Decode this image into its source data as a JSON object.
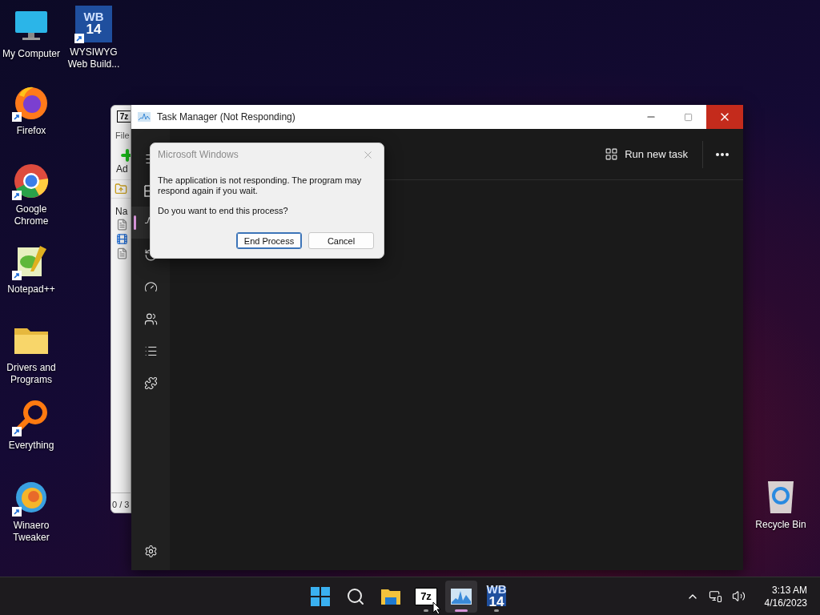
{
  "desktop_icons": [
    {
      "label": "My Computer",
      "kind": "computer",
      "shortcut": false
    },
    {
      "label": "WYSIWYG Web Build...",
      "kind": "wb",
      "logo": [
        "WB",
        "14"
      ],
      "shortcut": true
    },
    {
      "label": "Firefox",
      "kind": "firefox",
      "shortcut": true
    },
    {
      "label": "Google Chrome",
      "kind": "chrome",
      "shortcut": true
    },
    {
      "label": "Notepad++",
      "kind": "notepad",
      "shortcut": true
    },
    {
      "label": "Drivers and Programs",
      "kind": "folder",
      "shortcut": false
    },
    {
      "label": "Everything",
      "kind": "everything",
      "shortcut": true
    },
    {
      "label": "Winaero Tweaker",
      "kind": "winaero",
      "shortcut": true
    },
    {
      "label": "Recycle Bin",
      "kind": "recycle",
      "shortcut": false
    }
  ],
  "archive_window": {
    "logo": "7z",
    "menu": "File",
    "toolbar_button": "Ad",
    "column": "Na",
    "status": "0 / 3",
    "files": [
      {
        "kind": "document"
      },
      {
        "kind": "media"
      },
      {
        "kind": "document"
      }
    ]
  },
  "task_manager": {
    "title": "Task Manager (Not Responding)",
    "nav": [
      {
        "kind": "menu",
        "selected": false
      },
      {
        "kind": "processes",
        "selected": false
      },
      {
        "kind": "performance",
        "selected": true
      },
      {
        "kind": "history",
        "selected": false
      },
      {
        "kind": "startup",
        "selected": false
      },
      {
        "kind": "users",
        "selected": false
      },
      {
        "kind": "details",
        "selected": false
      },
      {
        "kind": "services",
        "selected": false
      }
    ],
    "run_new_task": "Run new task"
  },
  "dialog": {
    "title": "Microsoft Windows",
    "message": "The application is not responding. The program may respond again if you wait.",
    "question": "Do you want to end this process?",
    "buttons": [
      {
        "label": "End Process",
        "focused": true
      },
      {
        "label": "Cancel",
        "focused": false
      }
    ]
  },
  "taskbar": {
    "apps": [
      {
        "kind": "start",
        "running": false,
        "selected": false
      },
      {
        "kind": "search",
        "running": false,
        "selected": false
      },
      {
        "kind": "explorer",
        "running": false,
        "selected": false
      },
      {
        "kind": "sevenzip",
        "label": "7z",
        "running": true,
        "selected": false
      },
      {
        "kind": "taskmgr",
        "running": true,
        "selected": true
      },
      {
        "kind": "wb",
        "logo": [
          "WB",
          "14"
        ],
        "running": true,
        "selected": false
      }
    ],
    "time": "3:13 AM",
    "date": "4/16/2023"
  }
}
